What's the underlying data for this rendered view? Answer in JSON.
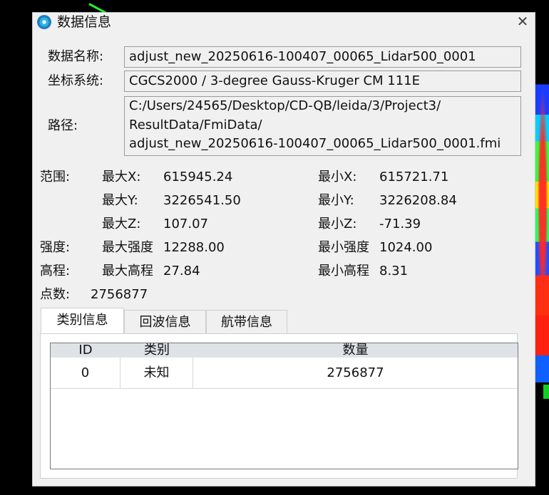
{
  "dialog": {
    "title": "数据信息",
    "close_glyph": "✕",
    "icon": "app-logo-icon"
  },
  "fields": {
    "name_label": "数据名称:",
    "name_value": "adjust_new_20250616-100407_00065_Lidar500_0001",
    "crs_label": "坐标系统:",
    "crs_value": "CGCS2000 / 3-degree Gauss-Kruger CM 111E",
    "path_label": "路径:",
    "path_lines": [
      "C:/Users/24565/Desktop/CD-QB/leida/3/Project3/",
      "ResultData/FmiData/",
      "adjust_new_20250616-100407_00065_Lidar500_0001.fmi"
    ]
  },
  "stats": {
    "range_label": "范围:",
    "max_x_label": "最大X:",
    "max_x": "615945.24",
    "min_x_label": "最小X:",
    "min_x": "615721.71",
    "max_y_label": "最大Y:",
    "max_y": "3226541.50",
    "min_y_label": "最小Y:",
    "min_y": "3226208.84",
    "max_z_label": "最大Z:",
    "max_z": "107.07",
    "min_z_label": "最小Z:",
    "min_z": "-71.39",
    "intensity_label": "强度:",
    "max_intensity_label": "最大强度",
    "max_intensity": "12288.00",
    "min_intensity_label": "最小强度",
    "min_intensity": "1024.00",
    "elevation_label": "高程:",
    "max_elev_label": "最大高程",
    "max_elev": "27.84",
    "min_elev_label": "最小高程",
    "min_elev": "8.31",
    "points_label": "点数:",
    "points": "2756877"
  },
  "tabs": [
    {
      "label": "类别信息",
      "active": true
    },
    {
      "label": "回波信息",
      "active": false
    },
    {
      "label": "航带信息",
      "active": false
    }
  ],
  "table": {
    "columns": [
      "ID",
      "类别",
      "数量"
    ],
    "rows": [
      {
        "id": "0",
        "category": "未知",
        "count": "2756877"
      }
    ]
  }
}
